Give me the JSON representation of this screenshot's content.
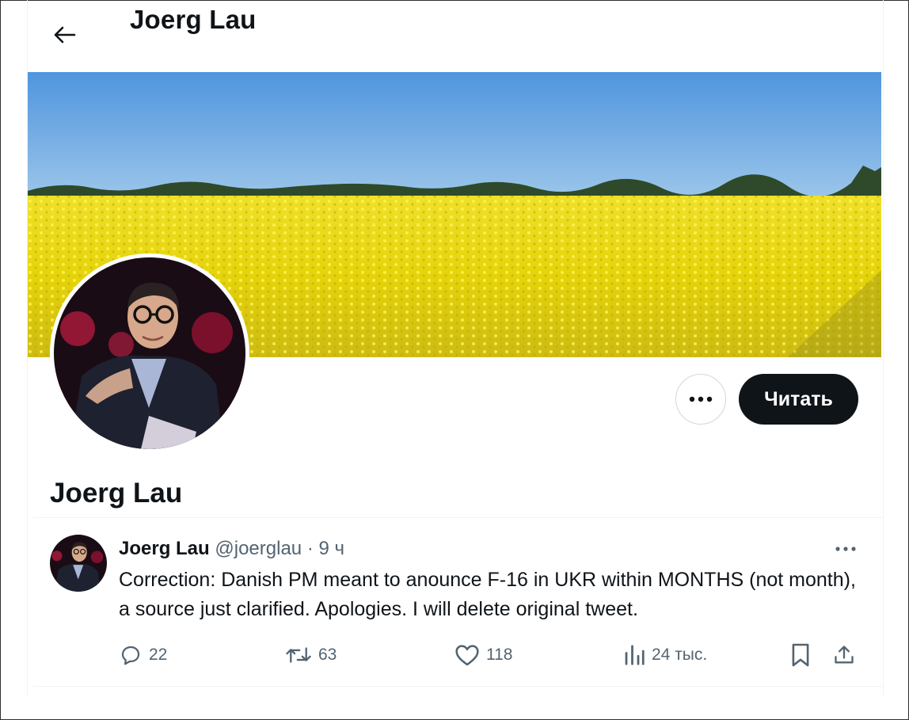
{
  "header": {
    "title": "Joerg Lau",
    "back_icon": "arrow-left-icon"
  },
  "profile": {
    "name": "Joerg Lau",
    "follow_label": "Читать",
    "more_icon": "more-horizontal-icon"
  },
  "tweet": {
    "author_name": "Joerg Lau",
    "handle": "@joerglau",
    "separator": "·",
    "time": "9 ч",
    "text": "Correction: Danish PM meant to anounce F-16 in UKR within MONTHS (not month), a source just clarified. Apologies. I will delete original tweet.",
    "replies": "22",
    "retweets": "63",
    "likes": "118",
    "views": "24 тыс.",
    "icons": {
      "reply": "reply-icon",
      "retweet": "retweet-icon",
      "like": "heart-icon",
      "views": "views-icon",
      "bookmark": "bookmark-icon",
      "share": "share-icon"
    }
  },
  "colors": {
    "text_primary": "#0f1419",
    "text_secondary": "#536471",
    "follow_bg": "#0f1419",
    "banner_sky": "#5b9ee0",
    "banner_field": "#e8d70c"
  }
}
